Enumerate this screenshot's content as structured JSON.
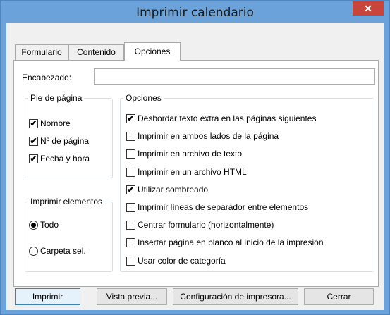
{
  "window": {
    "title": "Imprimir calendario",
    "close_glyph": "✕"
  },
  "tabs": [
    "Formulario",
    "Contenido",
    "Opciones"
  ],
  "header": {
    "label": "Encabezado:",
    "value": ""
  },
  "footer": {
    "legend": "Pie de página",
    "items": [
      {
        "label": "Nombre",
        "checked": true
      },
      {
        "label": "Nº de página",
        "checked": true
      },
      {
        "label": "Fecha y hora",
        "checked": true
      }
    ]
  },
  "print_items": {
    "legend": "Imprimir elementos",
    "items": [
      {
        "label": "Todo",
        "selected": true
      },
      {
        "label": "Carpeta sel.",
        "selected": false
      }
    ]
  },
  "options": {
    "legend": "Opciones",
    "items": [
      {
        "label": "Desbordar texto extra en las páginas siguientes",
        "checked": true
      },
      {
        "label": "Imprimir en ambos lados de la página",
        "checked": false
      },
      {
        "label": "Imprimir en archivo de texto",
        "checked": false
      },
      {
        "label": "Imprimir en un archivo HTML",
        "checked": false
      },
      {
        "label": "Utilizar sombreado",
        "checked": true
      },
      {
        "label": "Imprimir líneas de separador entre elementos",
        "checked": false
      },
      {
        "label": "Centrar formulario (horizontalmente)",
        "checked": false
      },
      {
        "label": "Insertar página en blanco al inicio de la impresión",
        "checked": false
      },
      {
        "label": "Usar color de categoría",
        "checked": false
      }
    ]
  },
  "buttons": {
    "print": "Imprimir",
    "preview": "Vista previa...",
    "setup": "Configuración de impresora...",
    "close": "Cerrar"
  }
}
